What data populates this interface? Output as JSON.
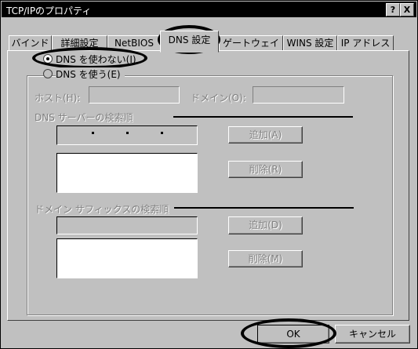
{
  "window": {
    "title": "TCP/IPのプロパティ",
    "help_label": "?",
    "close_label": "X"
  },
  "tabs": [
    {
      "label": "バインド"
    },
    {
      "label": "詳細設定"
    },
    {
      "label": "NetBIOS"
    },
    {
      "label": "DNS 設定"
    },
    {
      "label": "ゲートウェイ"
    },
    {
      "label": "WINS 設定"
    },
    {
      "label": "IP アドレス"
    }
  ],
  "dns": {
    "disable_label": "DNS を使わない(I)",
    "enable_label": "DNS を使う(E)",
    "selected": "disable",
    "host_label": "ホスト(H):",
    "host_value": "",
    "domain_label": "ドメイン(O):",
    "domain_value": "",
    "server_order_label": "DNS サーバーの検索順",
    "server_add_label": "追加(A)",
    "server_remove_label": "削除(R)",
    "suffix_order_label": "ドメイン サフィックスの検索順",
    "suffix_add_label": "追加(D)",
    "suffix_remove_label": "削除(M)"
  },
  "footer": {
    "ok_label": "OK",
    "cancel_label": "キャンセル"
  }
}
